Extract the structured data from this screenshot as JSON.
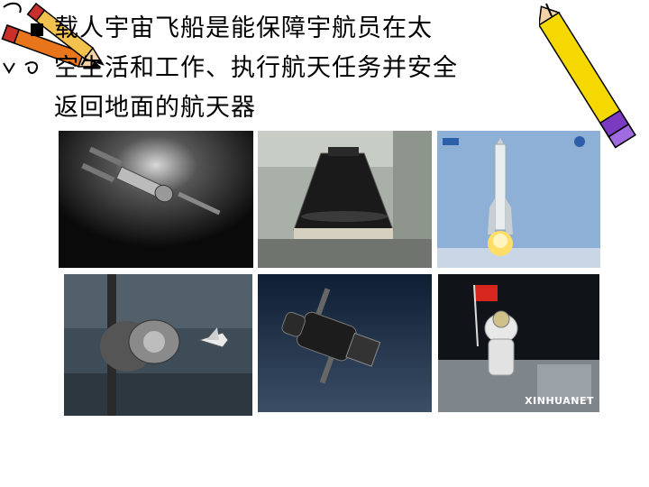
{
  "slide": {
    "text_lines": [
      "载人宇宙飞船是能保障宇航员在太",
      "空生活和工作、执行航天任务并安全",
      "返回地面的航天器"
    ]
  },
  "photos": {
    "photo6_caption": "XINHUANET"
  },
  "colors": {
    "text": "#000000",
    "pencil_body": "#f5d800",
    "pencil_band": "#7a3bc2",
    "pencil_orange": "#e8741c",
    "sky_blue": "#8fb0d6"
  }
}
